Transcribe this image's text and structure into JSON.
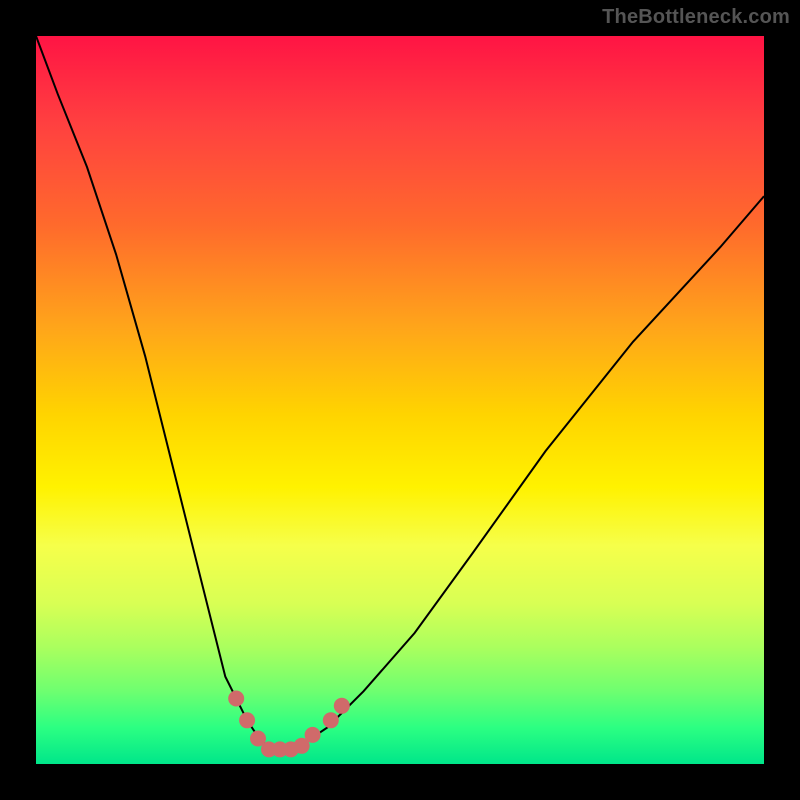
{
  "watermark": "TheBottleneck.com",
  "chart_data": {
    "type": "line",
    "title": "",
    "xlabel": "",
    "ylabel": "",
    "xlim": [
      0,
      100
    ],
    "ylim": [
      0,
      100
    ],
    "legend": false,
    "grid": false,
    "background_gradient": [
      "#ff1444",
      "#ff6a2c",
      "#ffd400",
      "#f6ff4a",
      "#6eff70",
      "#00e68a"
    ],
    "series": [
      {
        "name": "bottleneck-curve",
        "color": "#000000",
        "width": 2,
        "x": [
          0,
          3,
          7,
          11,
          15,
          19,
          23,
          26,
          29,
          31,
          33,
          35,
          37,
          40,
          45,
          52,
          60,
          70,
          82,
          94,
          100
        ],
        "values": [
          100,
          92,
          82,
          70,
          56,
          40,
          24,
          12,
          6,
          3,
          2,
          2,
          3,
          5,
          10,
          18,
          29,
          43,
          58,
          71,
          78
        ]
      },
      {
        "name": "highlight-dots",
        "color": "#d06a6a",
        "marker_radius": 8,
        "x": [
          27.5,
          29.0,
          30.5,
          32.0,
          33.5,
          35.0,
          36.5,
          38.0,
          40.5,
          42.0
        ],
        "values": [
          9.0,
          6.0,
          3.5,
          2.0,
          2.0,
          2.0,
          2.5,
          4.0,
          6.0,
          8.0
        ]
      }
    ]
  }
}
